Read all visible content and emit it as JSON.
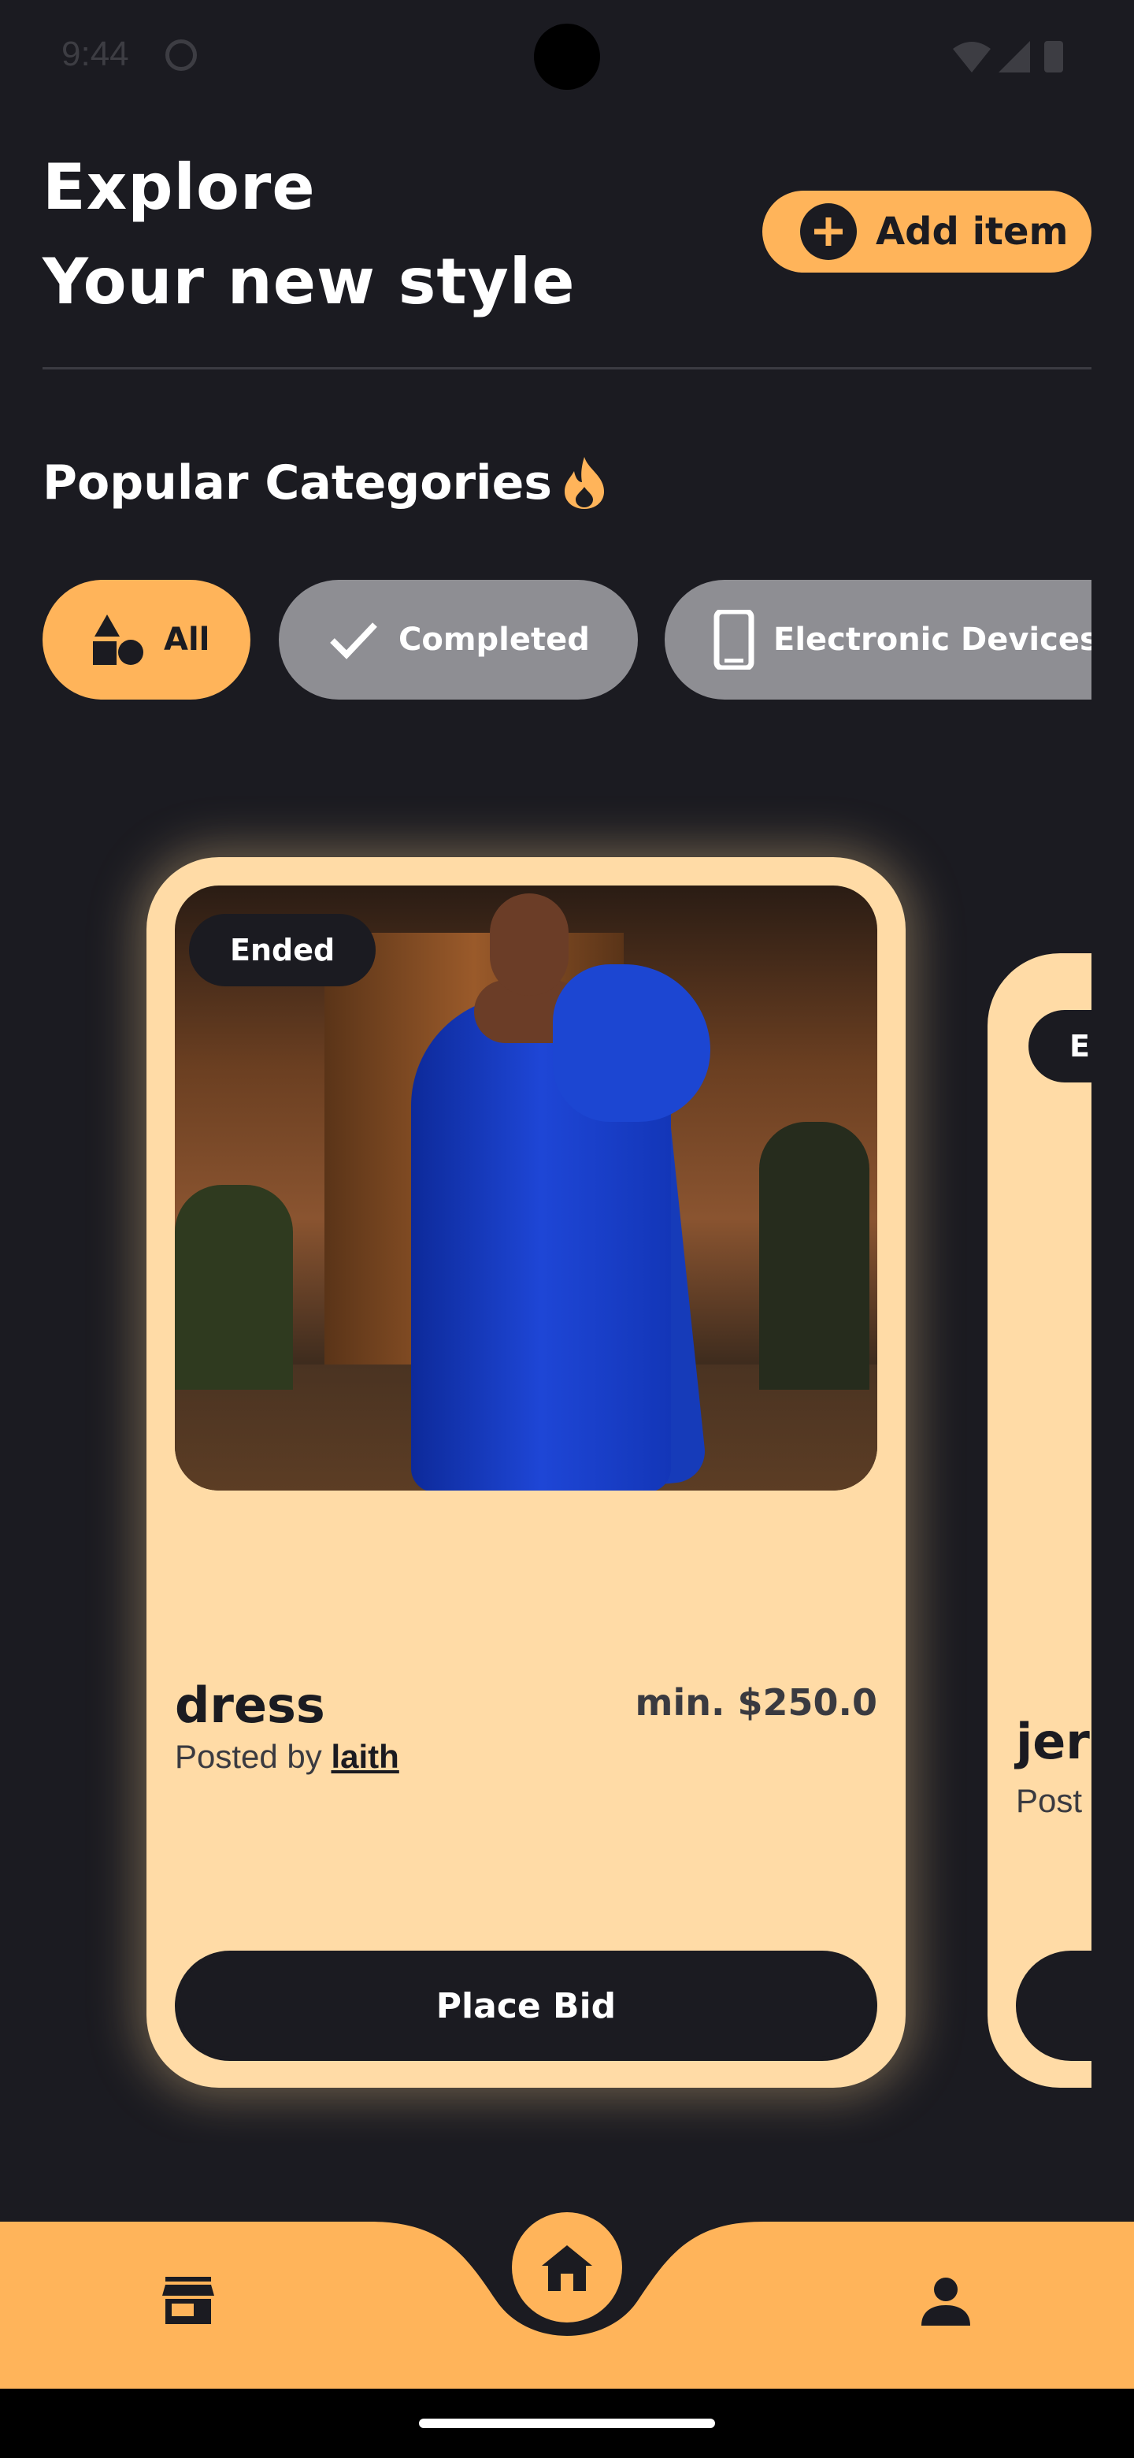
{
  "status_bar": {
    "time": "9:44"
  },
  "header": {
    "title_line1": "Explore",
    "title_line2": "Your new style",
    "add_item_label": "Add item"
  },
  "categories": {
    "title": "Popular Categories",
    "chips": [
      {
        "label": "All",
        "icon": "shapes-icon",
        "selected": true
      },
      {
        "label": "Completed",
        "icon": "check-icon",
        "selected": false
      },
      {
        "label": "Electronic Devices",
        "icon": "phone-icon",
        "selected": false
      }
    ]
  },
  "cards": [
    {
      "status": "Ended",
      "title": "dress",
      "price": "min. $250.0",
      "posted_prefix": "Posted by",
      "posted_by": "laith",
      "button_label": "Place Bid"
    },
    {
      "status": "En",
      "title": "jer",
      "posted_prefix": "Post"
    }
  ],
  "colors": {
    "background": "#1b1b21",
    "accent": "#ffb45a",
    "card": "#ffdba6",
    "chip_inactive": "#8e8e93"
  }
}
